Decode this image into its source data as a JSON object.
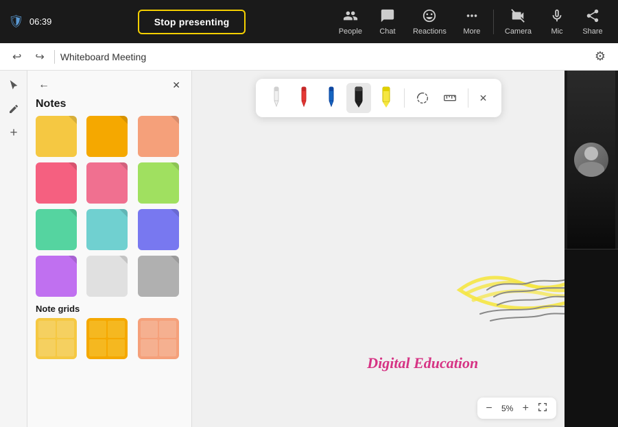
{
  "topbar": {
    "shield_icon": "🛡",
    "time": "06:39",
    "stop_presenting_label": "Stop presenting",
    "people_label": "People",
    "chat_label": "Chat",
    "reactions_label": "Reactions",
    "more_label": "More",
    "camera_label": "Camera",
    "mic_label": "Mic",
    "share_label": "Share"
  },
  "secondbar": {
    "meeting_title": "Whiteboard Meeting",
    "undo_icon": "↩",
    "redo_icon": "↪",
    "settings_icon": "⚙"
  },
  "sidebar": {
    "back_icon": "←",
    "close_icon": "✕",
    "notes_label": "Notes",
    "note_grids_label": "Note grids",
    "notes": [
      {
        "color": "#f5c842"
      },
      {
        "color": "#f5a800"
      },
      {
        "color": "#f5a07a"
      },
      {
        "color": "#f5607a"
      },
      {
        "color": "#f56090"
      },
      {
        "color": "#a8f56c"
      },
      {
        "color": "#5ad4a0"
      },
      {
        "color": "#62d4d4"
      },
      {
        "color": "#8080f0"
      },
      {
        "color": "#c078f0"
      },
      {
        "color": "#e0e0e0"
      },
      {
        "color": "#b0b0b0"
      }
    ],
    "grids": [
      {
        "color1": "#f5c842"
      },
      {
        "color1": "#f5a800"
      },
      {
        "color1": "#f5a07a"
      }
    ]
  },
  "toolbar": {
    "select_icon": "⬆",
    "pen_icon": "✏",
    "add_icon": "+"
  },
  "palette": {
    "close_icon": "✕",
    "lasso_icon": "⊙",
    "ruler_icon": "📏",
    "tools": [
      {
        "name": "white-pen",
        "symbol": "✒",
        "color": "#ccc"
      },
      {
        "name": "red-pen",
        "symbol": "✒",
        "color": "#e53935"
      },
      {
        "name": "blue-pen",
        "symbol": "✒",
        "color": "#1565c0"
      },
      {
        "name": "black-marker",
        "symbol": "▋",
        "color": "#212121"
      },
      {
        "name": "yellow-highlighter",
        "symbol": "▋",
        "color": "#f5e642"
      }
    ]
  },
  "whiteboard": {
    "digital_education_text": "Digital Education",
    "zoom_level": "5%",
    "zoom_in_icon": "+",
    "zoom_out_icon": "−",
    "fit_icon": "⊡"
  }
}
